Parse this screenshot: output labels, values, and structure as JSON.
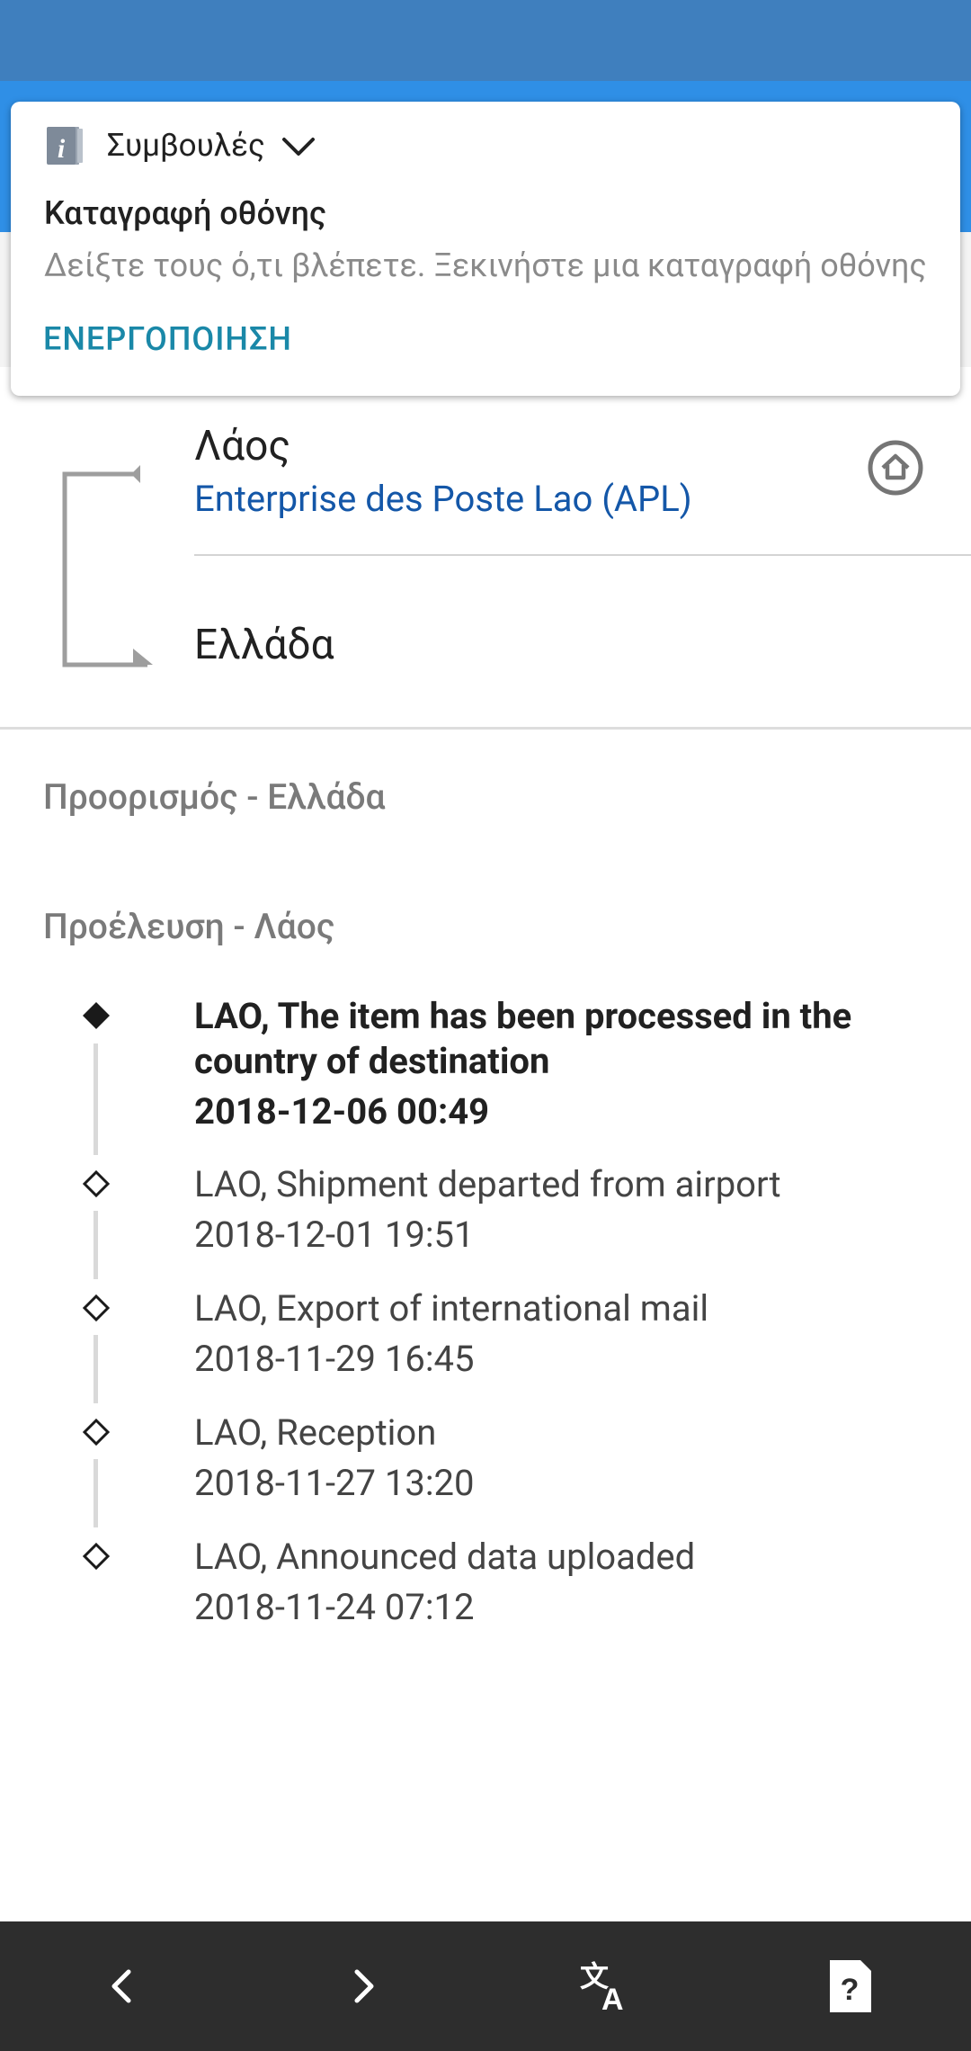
{
  "tips": {
    "header_label": "Συμβουλές",
    "title": "Καταγραφή οθόνης",
    "description": "Δείξτε τους ό,τι βλέπετε. Ξεκινήστε μια καταγραφή οθόνης",
    "action_label": "ΕΝΕΡΓΟΠΟΙΗΣΗ"
  },
  "route": {
    "origin_country": "Λάος",
    "origin_carrier": "Enterprise des Poste Lao (APL)",
    "destination_country": "Ελλάδα"
  },
  "sections": {
    "destination_label": "Προορισμός - Ελλάδα",
    "origin_label": "Προέλευση - Λάος"
  },
  "events": [
    {
      "line1": "LAO, The item has been processed in the",
      "line2": "country of destination",
      "date": "2018-12-06 00:49"
    },
    {
      "line1": "LAO, Shipment departed from airport",
      "date": "2018-12-01 19:51"
    },
    {
      "line1": "LAO, Export of international mail",
      "date": "2018-11-29 16:45"
    },
    {
      "line1": "LAO, Reception",
      "date": "2018-11-27 13:20"
    },
    {
      "line1": "LAO, Announced data uploaded",
      "date": "2018-11-24 07:12"
    }
  ],
  "icons": {
    "tips": "info-icon",
    "expand": "chevron-down-icon",
    "home": "home-icon",
    "back": "chevron-left-icon",
    "forward": "chevron-right-icon",
    "translate": "translate-icon",
    "help": "help-icon"
  },
  "colors": {
    "status_bar": "#3f7fbe",
    "header": "#2f8fe6",
    "link": "#1457a8",
    "action": "#1a88a8",
    "bottom_bar": "#2d2d2d"
  }
}
